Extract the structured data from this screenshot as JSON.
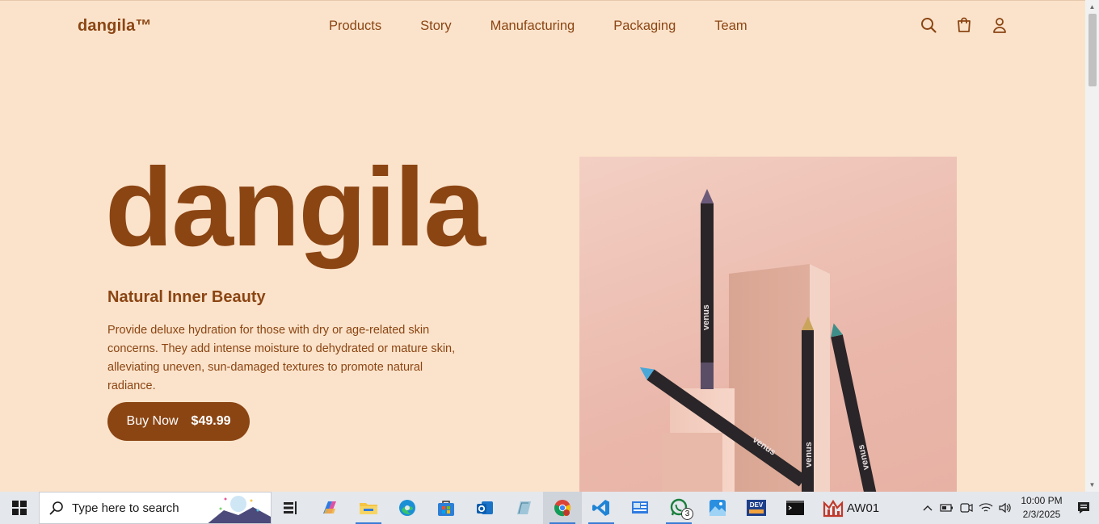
{
  "brand": "dangila™",
  "nav": {
    "items": [
      "Products",
      "Story",
      "Manufacturing",
      "Packaging",
      "Team"
    ]
  },
  "nav_icons": [
    "search-icon",
    "cart-icon",
    "user-icon"
  ],
  "hero": {
    "title": "dangila",
    "subtitle": "Natural Inner Beauty",
    "description": "Provide deluxe hydration for those with dry or age-related skin concerns. They add intense moisture to dehydrated or mature skin, alleviating uneven, sun-damaged textures to promote natural radiance.",
    "buy_label": "Buy Now",
    "price": "$49.99",
    "pencil_label": "venus"
  },
  "colors": {
    "accent": "#8b4513",
    "background": "#fbe3cb"
  },
  "taskbar": {
    "search_placeholder": "Type here to search",
    "apps": [
      "task-view-icon",
      "copilot-icon",
      "file-explorer-icon",
      "edge-icon",
      "store-icon",
      "outlook-icon",
      "notepad-icon",
      "chrome-icon",
      "vscode-icon",
      "control-panel-icon",
      "whatsapp-icon",
      "photos-icon",
      "devexpress-icon",
      "terminal-icon",
      "aw01-icon"
    ],
    "whatsapp_badge": "3",
    "aw_label": "AW01",
    "clock_time": "10:00 PM",
    "clock_date": "2/3/2025"
  }
}
